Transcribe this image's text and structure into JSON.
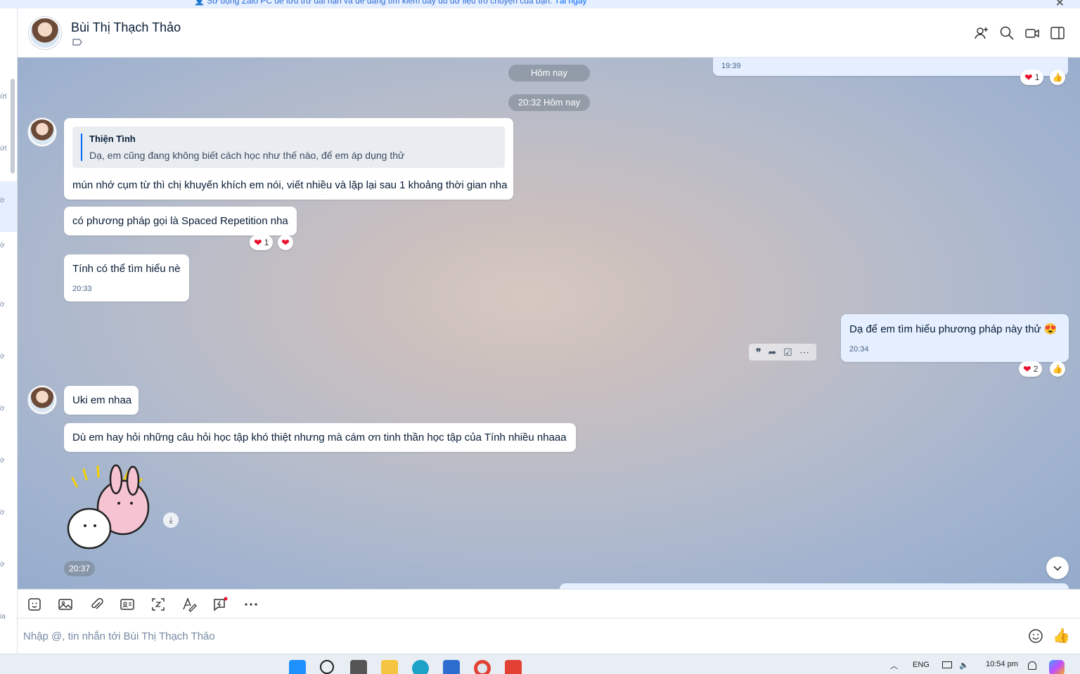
{
  "banner": {
    "text": "Sử dụng Zalo PC để lưu trữ dài hạn và dễ dàng tìm kiếm đầy đủ dữ liệu trò chuyện của bạn.",
    "link": "Tải ngay"
  },
  "sidebar": {
    "fragments": [
      "ứt",
      "ứt",
      "ờ",
      "ờ",
      "ờ",
      "ờ",
      "ờ",
      "ờ",
      "ờ",
      "ờ",
      "ia"
    ]
  },
  "header": {
    "name": "Bùi Thị Thạch Thảo",
    "icons": [
      "add-member-icon",
      "search-icon",
      "video-call-icon",
      "sidebar-toggle-icon"
    ]
  },
  "chat": {
    "prev_time": "19:39",
    "prev_reaction_count": "1",
    "day_label": "Hôm nay",
    "time_label": "20:32 Hôm nay",
    "messages": [
      {
        "quote_name": "Thiện Tình",
        "quote_text": "Dạ, em cũng đang không biết cách học như thế nào, để em áp dụng thử",
        "text": "mún nhớ cụm từ thì chị khuyến khích em nói, viết nhiều và lặp lại sau 1 khoảng thời gian nha"
      },
      {
        "text": "có phương pháp gọi là Spaced Repetition nha",
        "reaction_count": "1"
      },
      {
        "text": "Tính có thể tìm hiểu nè",
        "time": "20:33"
      },
      {
        "text": "Dạ để em tìm hiểu phương pháp này thử",
        "time": "20:34",
        "reaction_count": "2"
      },
      {
        "text": "Uki em nhaa"
      },
      {
        "text": "Dù em hay hỏi những câu hỏi học tập khó thiệt nhưng mà cám ơn tinh thần học tập của Tính nhiều nhaaa"
      },
      {
        "sticker": "kanahei-rabbit-sticker",
        "time": "20:37"
      }
    ]
  },
  "composer": {
    "placeholder": "Nhập @, tin nhắn tới Bùi Thị Thạch Thảo"
  },
  "toolbar": {
    "icons": [
      "sticker-icon",
      "image-icon",
      "attach-icon",
      "contact-card-icon",
      "screenshot-icon",
      "format-icon",
      "quick-message-icon",
      "more-icon"
    ]
  },
  "taskbar": {
    "lang": "ENG",
    "time": "10:54 pm"
  },
  "colors": {
    "accent": "#0068ff",
    "my_bubble": "#e5efff",
    "heart": "#e8112d"
  }
}
